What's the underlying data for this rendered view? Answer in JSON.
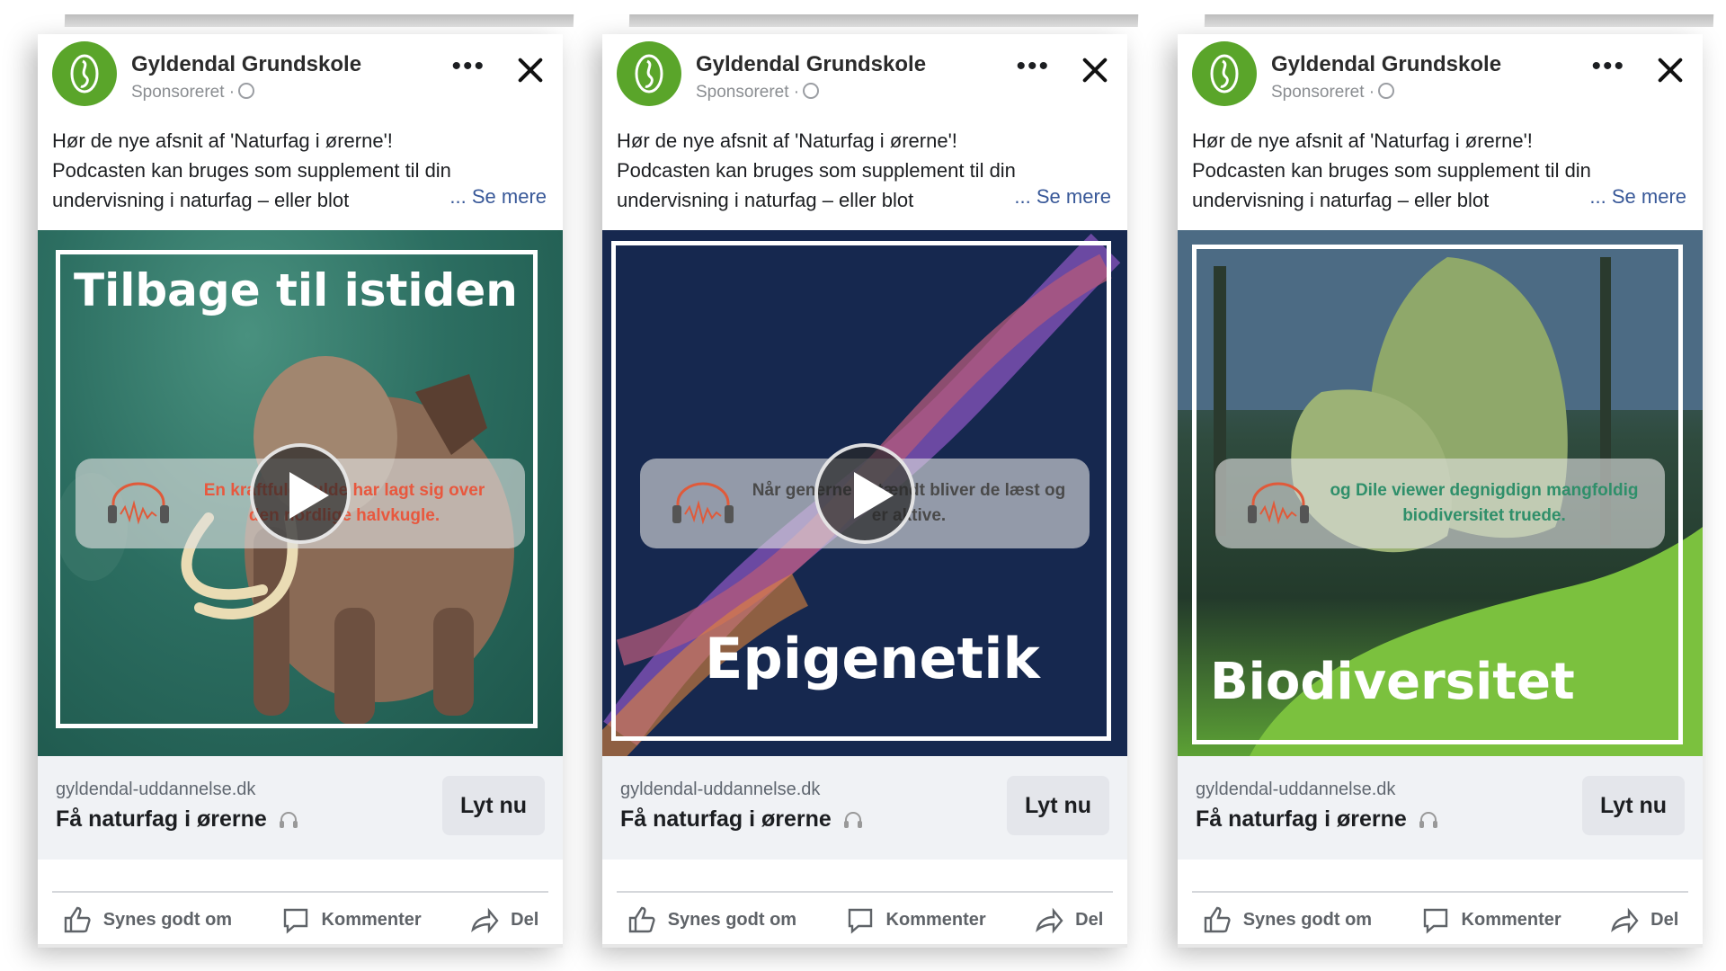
{
  "ads": [
    {
      "page_name": "Gyldendal Grundskole",
      "sponsored": "Sponsoreret ·",
      "text_lines": [
        "Hør de nye afsnit af 'Naturfag i ørerne'!",
        "Podcasten kan bruges som supplement til din",
        "undervisning i naturfag – eller blot"
      ],
      "see_more": "... Se mere",
      "headline": "Tilbage til istiden",
      "audio_caption": "En kraftfuld kulde har lagt sig over den nordlige halvkugle.",
      "caption_color": "#e8583e",
      "domain": "gyldendal-uddannelse.dk",
      "cta_headline": "Få naturfag i ørerne",
      "cta_button": "Lyt nu"
    },
    {
      "page_name": "Gyldendal Grundskole",
      "sponsored": "Sponsoreret ·",
      "text_lines": [
        "Hør de nye afsnit af 'Naturfag i ørerne'!",
        "Podcasten kan bruges som supplement til din",
        "undervisning i naturfag – eller blot"
      ],
      "see_more": "... Se mere",
      "headline": "Epigenetik",
      "audio_caption": "Når generne er tændt bliver de læst og er aktive.",
      "caption_color": "#4a4a4a",
      "domain": "gyldendal-uddannelse.dk",
      "cta_headline": "Få naturfag i ørerne",
      "cta_button": "Lyt nu"
    },
    {
      "page_name": "Gyldendal Grundskole",
      "sponsored": "Sponsoreret ·",
      "text_lines": [
        "Hør de nye afsnit af 'Naturfag i ørerne'!",
        "Podcasten kan bruges som supplement til din",
        "undervisning i naturfag – eller blot"
      ],
      "see_more": "... Se mere",
      "headline": "Biodiversitet",
      "audio_caption": "og Dile viewer degnigdign mangfoldig biodiversitet truede.",
      "caption_color": "#2f8f6a",
      "domain": "gyldendal-uddannelse.dk",
      "cta_headline": "Få naturfag i ørerne",
      "cta_button": "Lyt nu"
    }
  ],
  "actions": {
    "like": "Synes godt om",
    "comment": "Kommenter",
    "share": "Del"
  },
  "colors": {
    "brand_green": "#5aa52a",
    "link_blue": "#385898",
    "cta_bg": "#e4e6eb"
  }
}
